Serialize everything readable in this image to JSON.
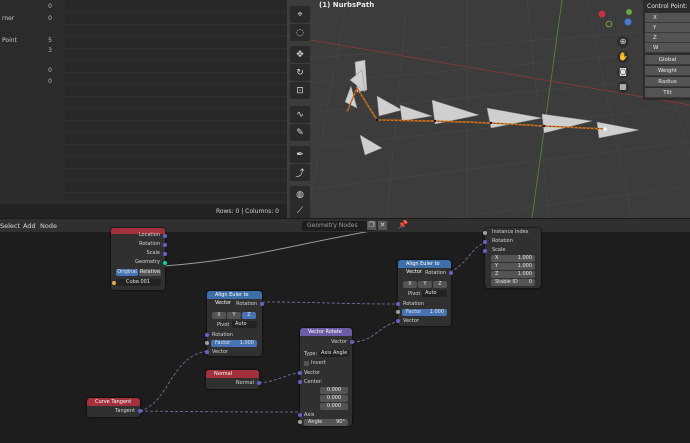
{
  "spreadsheet": {
    "labels": [
      "rner",
      "Point"
    ],
    "numbers": [
      "0",
      "0",
      "5",
      "3",
      "0",
      "0"
    ],
    "footer": "Rows: 0  |  Columns: 0"
  },
  "viewport": {
    "title": "(1) NurbsPath",
    "control_point_title": "Control Point:",
    "cp_fields": [
      "X",
      "Y",
      "Z",
      "W"
    ],
    "cp_buttons": [
      "Global",
      "Weight",
      "Radius",
      "Tilt"
    ]
  },
  "node_header": {
    "menu": [
      "Select",
      "Add",
      "Node"
    ],
    "tree_name": "Geometry Nodes"
  },
  "nodes": {
    "object_info": {
      "outputs": [
        "Location",
        "Rotation",
        "Scale",
        "Geometry"
      ],
      "toggle_a": "Original",
      "toggle_b": "Relative",
      "object": "Cube.001"
    },
    "instance_info": {
      "outputs": [
        "Instance Index",
        "Rotation",
        "Scale"
      ],
      "x": "X",
      "y": "Y",
      "z": "Z",
      "xv": "1.000",
      "yv": "1.000",
      "zv": "1.000",
      "stable_id": "Stable ID",
      "stable_val": "0"
    },
    "align1": {
      "title": "Align Euler to Vector",
      "out": "Rotation",
      "axes": [
        "X",
        "Y",
        "Z"
      ],
      "pivot_label": "Pivot",
      "pivot_value": "Auto",
      "in_rotation": "Rotation",
      "factor_label": "Factor",
      "factor_value": "1.000",
      "in_vector": "Vector"
    },
    "align2": {
      "title": "Align Euler to Vector",
      "out": "Rotation",
      "axes": [
        "X",
        "Y",
        "Z"
      ],
      "pivot_label": "Pivot",
      "pivot_value": "Auto",
      "in_rotation": "Rotation",
      "factor_label": "Factor",
      "factor_value": "1.000",
      "in_vector": "Vector"
    },
    "vector_rotate": {
      "title": "Vector Rotate",
      "out": "Vector",
      "type_label": "Type:",
      "type_value": "Axis Angle",
      "invert": "Invert",
      "in_vector": "Vector",
      "center": "Center:",
      "center_vals": [
        "0.000",
        "0.000",
        "0.000"
      ],
      "axis": "Axis",
      "angle_label": "Angle",
      "angle_value": "90°"
    },
    "normal": {
      "title": "Normal",
      "out": "Normal"
    },
    "curve_tangent": {
      "title": "Curve Tangent",
      "out": "Tangent"
    }
  },
  "colors": {
    "header_blue": "#3f6fa8",
    "header_purple": "#6b5ca5",
    "header_red": "#a3303d",
    "curve_orange": "#e07a1c"
  }
}
